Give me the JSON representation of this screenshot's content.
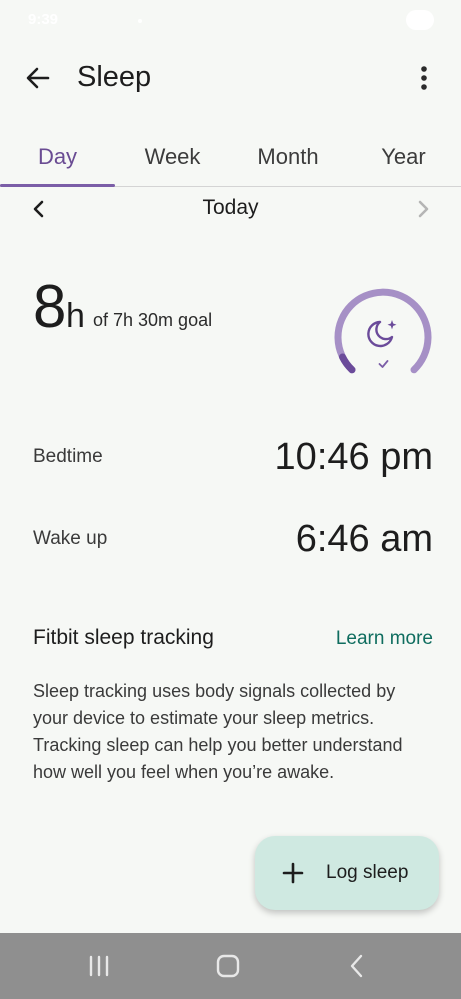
{
  "status_bar": {
    "time": "9:39",
    "battery": "34"
  },
  "app_bar": {
    "title": "Sleep",
    "back_icon": "arrow-left-icon",
    "more_icon": "more-vertical-icon"
  },
  "tabs": [
    {
      "label": "Day",
      "active": true
    },
    {
      "label": "Week",
      "active": false
    },
    {
      "label": "Month",
      "active": false
    },
    {
      "label": "Year",
      "active": false
    }
  ],
  "date_nav": {
    "label": "Today",
    "prev_icon": "chevron-left-icon",
    "next_icon": "chevron-right-icon"
  },
  "summary": {
    "hours": "8",
    "unit": "h",
    "goal_text": "of 7h 30m goal",
    "goal_progress": 1.0,
    "ring_icon": "moon-stars-icon",
    "check_icon": "check-icon"
  },
  "bedtime": {
    "label": "Bedtime",
    "value": "10:46 pm"
  },
  "wakeup": {
    "label": "Wake up",
    "value": "6:46 am"
  },
  "tracking": {
    "title": "Fitbit sleep tracking",
    "link": "Learn more",
    "description": "Sleep tracking uses body signals collected by your device to estimate your sleep metrics. Tracking sleep can help you better understand how well you feel when you’re awake."
  },
  "fab": {
    "label": "Log sleep",
    "icon": "plus-icon"
  },
  "colors": {
    "accent": "#7b5ea7",
    "link": "#0f6d5f",
    "fab_bg": "#cfe9e1",
    "background": "#f6f8f5",
    "ring_track": "#a690c6",
    "ring_dark": "#6b4b9a"
  }
}
